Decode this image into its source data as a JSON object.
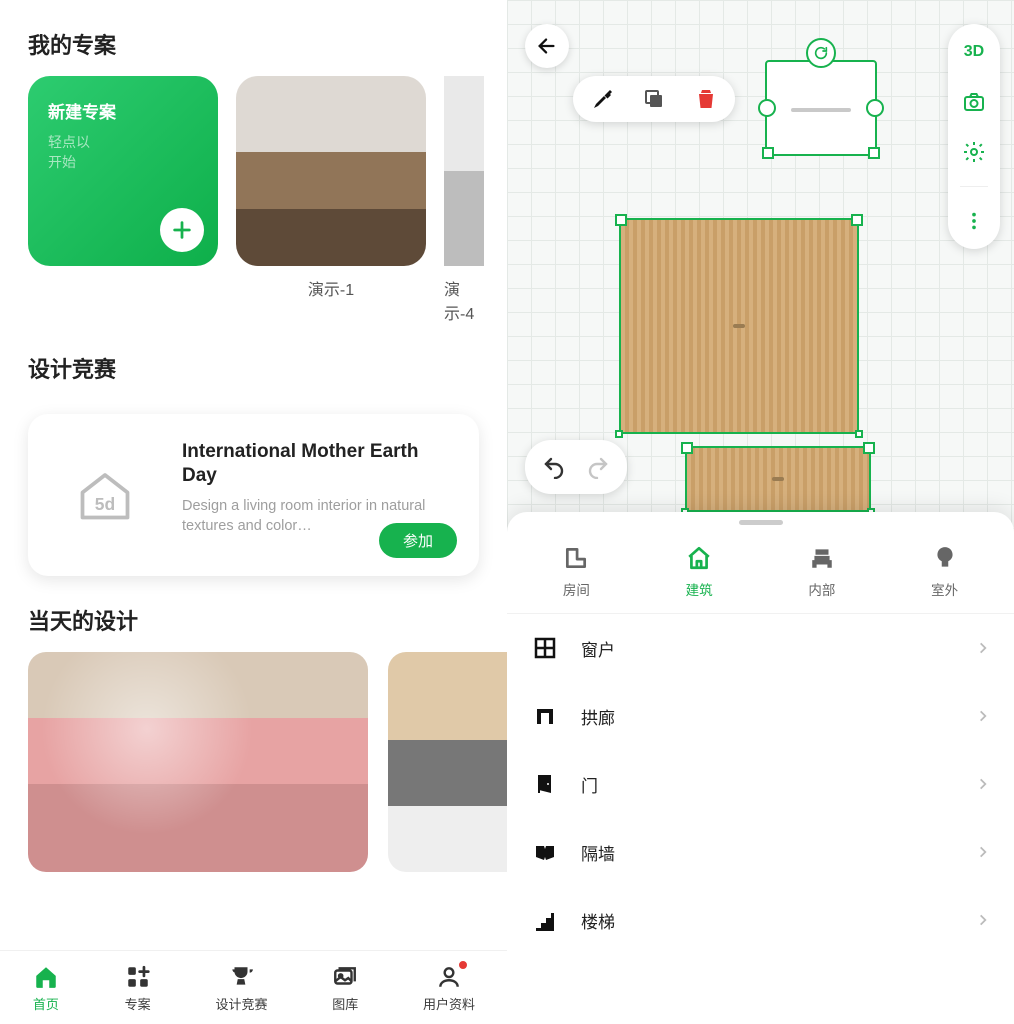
{
  "left": {
    "sections": {
      "projects_title": "我的专案",
      "contests_title": "设计竞赛",
      "daily_title": "当天的设计"
    },
    "new_project": {
      "title": "新建专案",
      "hint_line1": "轻点以",
      "hint_line2": "开始"
    },
    "projects": [
      {
        "label": "演示-1"
      },
      {
        "label": "演示-4"
      }
    ],
    "contest": {
      "title": "International Mother Earth Day",
      "desc": "Design a living room interior in natural textures and color…",
      "join_label": "参加",
      "logo_text": "5d"
    },
    "nav": [
      {
        "label": "首页",
        "icon": "home-icon",
        "active": true
      },
      {
        "label": "专案",
        "icon": "grid-plus-icon"
      },
      {
        "label": "设计竞赛",
        "icon": "trophy-icon"
      },
      {
        "label": "图库",
        "icon": "gallery-icon"
      },
      {
        "label": "用户资料",
        "icon": "profile-icon",
        "badge": true
      }
    ]
  },
  "right": {
    "view_mode_label": "3D",
    "categories": [
      {
        "label": "房间",
        "icon": "room-icon"
      },
      {
        "label": "建筑",
        "icon": "building-icon",
        "active": true
      },
      {
        "label": "内部",
        "icon": "interior-icon"
      },
      {
        "label": "室外",
        "icon": "outdoor-icon"
      }
    ],
    "items": [
      {
        "label": "窗户",
        "icon": "window-icon"
      },
      {
        "label": "拱廊",
        "icon": "arch-icon"
      },
      {
        "label": "门",
        "icon": "door-icon"
      },
      {
        "label": "隔墙",
        "icon": "partition-icon"
      },
      {
        "label": "楼梯",
        "icon": "stairs-icon"
      }
    ]
  }
}
